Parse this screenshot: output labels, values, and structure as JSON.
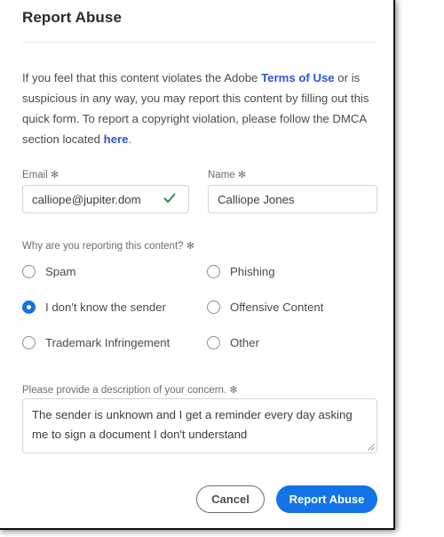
{
  "dialog": {
    "title": "Report Abuse",
    "intro": {
      "part1": "If you feel that this content violates the Adobe ",
      "link1": "Terms of Use",
      "part2": " or is suspicious in any way, you may report this content by filling out this quick form. To report a copyright violation, please follow the DMCA section located ",
      "link2": "here",
      "part3": "."
    },
    "fields": {
      "email": {
        "label": "Email",
        "required_mark": "✻",
        "value": "calliope@jupiter.dom",
        "placeholder": "",
        "valid_icon": "checkmark-icon"
      },
      "name": {
        "label": "Name",
        "required_mark": "✻",
        "value": "Calliope Jones",
        "placeholder": ""
      }
    },
    "reason_group": {
      "label": "Why are you reporting this content?",
      "required_mark": "✻",
      "options": [
        {
          "label": "Spam",
          "selected": false
        },
        {
          "label": "Phishing",
          "selected": false
        },
        {
          "label": "I don't know the sender",
          "selected": true
        },
        {
          "label": "Offensive Content",
          "selected": false
        },
        {
          "label": "Trademark Infringement",
          "selected": false
        },
        {
          "label": "Other",
          "selected": false
        }
      ]
    },
    "description": {
      "label": "Please provide a description of your concern.",
      "required_mark": "✻",
      "value": "The sender is unknown and I get a reminder every day asking me to sign a document I don't understand",
      "placeholder": ""
    },
    "buttons": {
      "cancel": "Cancel",
      "submit": "Report Abuse"
    }
  },
  "colors": {
    "accent_blue": "#1473e6",
    "link_blue": "#2b54d8",
    "valid_green": "#2e8b57",
    "label_gray": "#6e6e6e",
    "text_gray": "#4b4b4b",
    "border_gray": "#d3d3d3"
  }
}
